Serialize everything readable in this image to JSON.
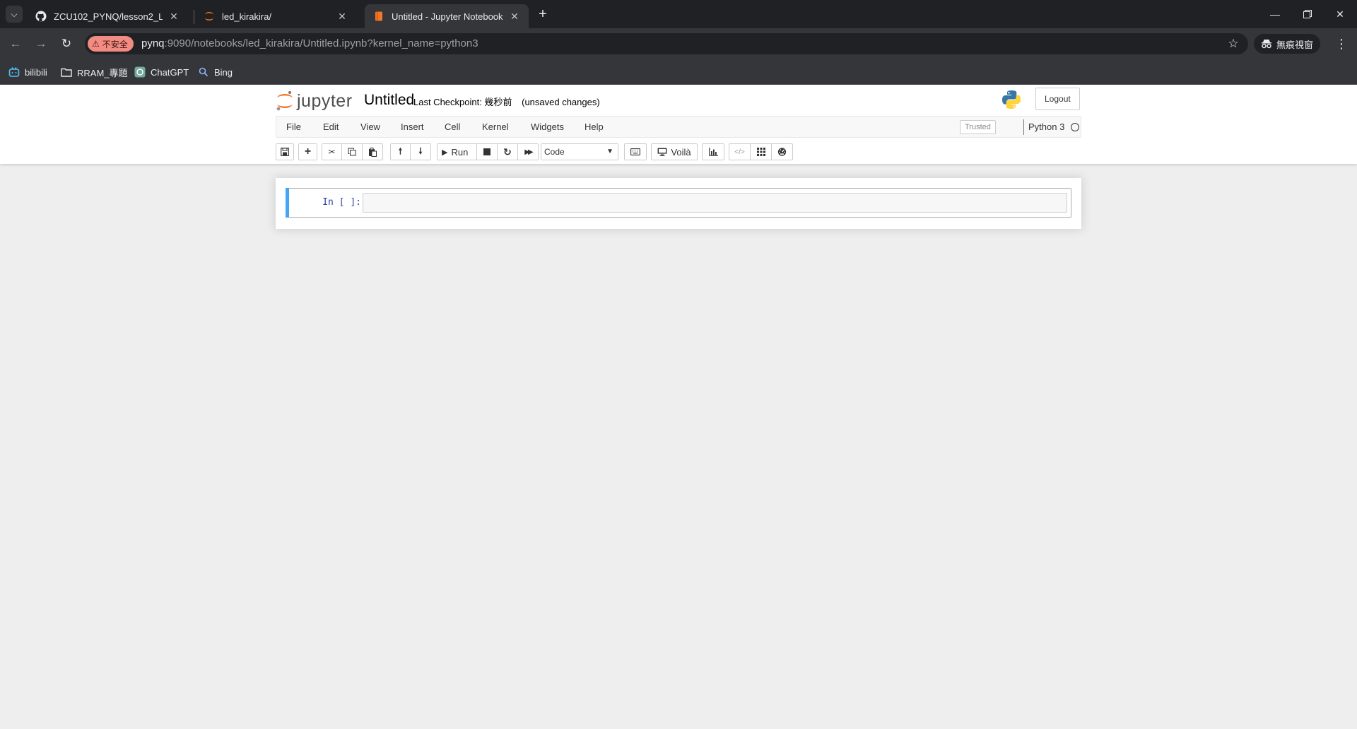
{
  "browser": {
    "tabs": [
      {
        "title": "ZCU102_PYNQ/lesson2_LED_",
        "icon": "github-icon"
      },
      {
        "title": "led_kirakira/",
        "icon": "jupyter-icon"
      },
      {
        "title": "Untitled - Jupyter Notebook",
        "icon": "notebook-icon",
        "active": true
      }
    ],
    "security_label": "不安全",
    "url_host": "pynq",
    "url_path": ":9090/notebooks/led_kirakira/Untitled.ipynb?kernel_name=python3",
    "incognito_label": "無痕視窗",
    "bookmarks": [
      {
        "label": "bilibili",
        "icon": "bilibili-icon"
      },
      {
        "label": "RRAM_專題",
        "icon": "folder-icon"
      },
      {
        "label": "ChatGPT",
        "icon": "chatgpt-icon"
      },
      {
        "label": "Bing",
        "icon": "search-icon"
      }
    ]
  },
  "jupyter": {
    "logo_text": "jupyter",
    "notebook_name": "Untitled",
    "checkpoint_label": "Last Checkpoint:",
    "checkpoint_time": "幾秒前",
    "autosave_status": "(unsaved changes)",
    "logout_label": "Logout",
    "menu": [
      "File",
      "Edit",
      "View",
      "Insert",
      "Cell",
      "Kernel",
      "Widgets",
      "Help"
    ],
    "trusted_label": "Trusted",
    "kernel_name": "Python 3",
    "toolbar": {
      "run_label": "Run",
      "cell_type": "Code",
      "voila_label": "Voilà"
    },
    "cell": {
      "prompt": "In [ ]:",
      "source": ""
    }
  },
  "colors": {
    "cell_selected_bar": "#42a5f5",
    "jupyter_orange": "#f37726",
    "prompt_blue": "#303f9f"
  }
}
